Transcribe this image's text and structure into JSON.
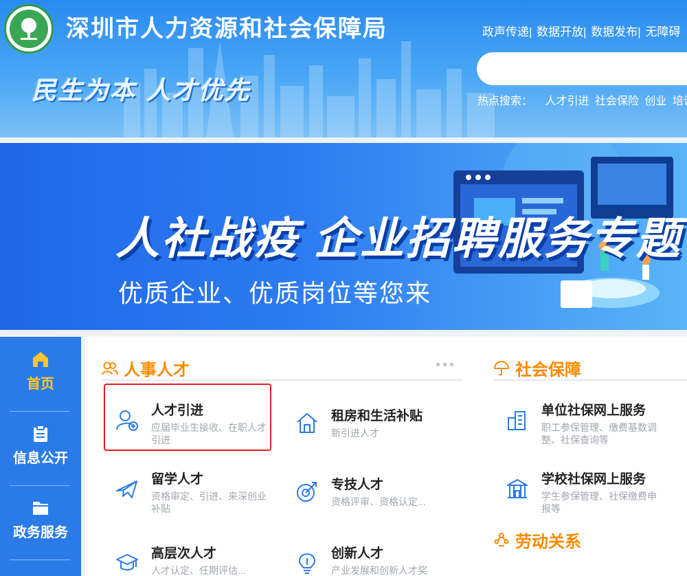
{
  "header": {
    "site_title": "深圳市人力资源和社会保障局",
    "slogan": "民生为本 人才优先",
    "top_links": [
      "政声传递|",
      "数据开放|",
      "数据发布|",
      "无障碍"
    ],
    "hot_search_label": "热点搜索：",
    "hot_keywords": [
      "人才引进",
      "社会保险",
      "创业",
      "培训"
    ]
  },
  "banner": {
    "title": "人社战疫 企业招聘服务专题",
    "subtitle": "优质企业、优质岗位等您来"
  },
  "sidebar": {
    "items": [
      {
        "label": "首页",
        "icon": "home-icon",
        "active": true
      },
      {
        "label": "信息公开",
        "icon": "clipboard-icon",
        "active": false
      },
      {
        "label": "政务服务",
        "icon": "folder-icon",
        "active": false
      }
    ]
  },
  "sections": {
    "personnel": {
      "title": "人事人才",
      "items": [
        {
          "title": "人才引进",
          "desc": "应届毕业生接收、在职人才引进",
          "icon": "user-add-icon"
        },
        {
          "title": "租房和生活补贴",
          "desc": "新引进人才",
          "icon": "house-icon"
        },
        {
          "title": "留学人才",
          "desc": "资格审定、引进、来深创业补贴",
          "icon": "airplane-icon"
        },
        {
          "title": "专技人才",
          "desc": "资格评审、资格认定...",
          "icon": "target-icon"
        },
        {
          "title": "高层次人才",
          "desc": "人才认定、任期评估...",
          "icon": "graduation-cap-icon"
        },
        {
          "title": "创新人才",
          "desc": "产业发展和创新人才奖",
          "icon": "lightbulb-icon"
        }
      ]
    },
    "social": {
      "title": "社会保障",
      "items": [
        {
          "title": "单位社保网上服务",
          "desc": "职工参保管理、缴费基数调整、社保查询等",
          "icon": "building-icon"
        },
        {
          "title": "学校社保网上服务",
          "desc": "学生参保管理、社保缴费申报等",
          "icon": "school-icon"
        }
      ]
    },
    "labor": {
      "title": "劳动关系"
    }
  },
  "colors": {
    "accent": "#ff8a00",
    "primary": "#2a7be8",
    "highlight_border": "#e81d1d"
  }
}
